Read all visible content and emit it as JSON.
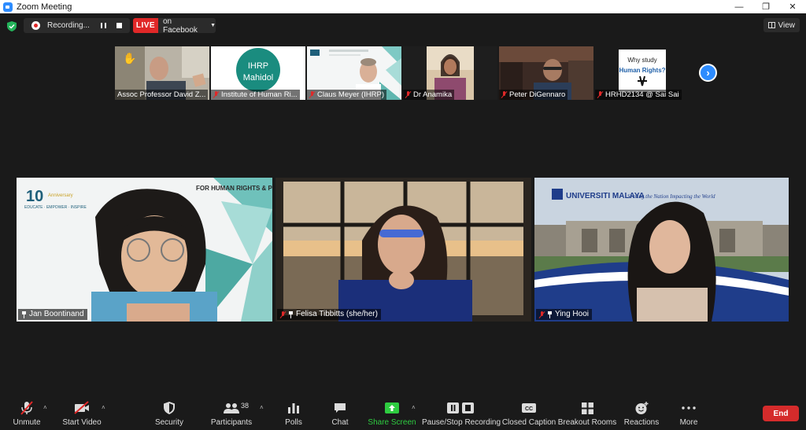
{
  "window": {
    "title": "Zoom Meeting"
  },
  "recording": {
    "status": "Recording..."
  },
  "live": {
    "badge": "LIVE",
    "target": "on Facebook"
  },
  "view": {
    "label": "View"
  },
  "thumbnails": [
    {
      "name": "Assoc Professor David Z...",
      "muted": false
    },
    {
      "name": "Institute of Human Ri...",
      "muted": true
    },
    {
      "name": "Claus Meyer (IHRP)",
      "muted": true
    },
    {
      "name": "Dr Anamika",
      "muted": true
    },
    {
      "name": "Peter DiGennaro",
      "muted": true
    },
    {
      "name": "HRHD2134 @ Sai Sai",
      "muted": true
    }
  ],
  "thumb_content": {
    "ihrp_logo": [
      "IHRP",
      "Mahidol"
    ],
    "why_study": [
      "Why study",
      "Human Rights?"
    ]
  },
  "tiles": [
    {
      "name": "Jan Boontinand",
      "banner": "FOR HUMAN RIGHTS & PEACE",
      "tagline": "EDUCATE · EMPOWER · INSPIRE",
      "anniv": "Anniversary"
    },
    {
      "name": "Felisa Tibbitts (she/her)"
    },
    {
      "name": "Ying Hooi",
      "org": "UNIVERSITI MALAYA",
      "motto": "Serving the Nation Impacting the World"
    }
  ],
  "toolbar": {
    "unmute": "Unmute",
    "start_video": "Start Video",
    "security": "Security",
    "participants": "Participants",
    "participants_count": "38",
    "polls": "Polls",
    "chat": "Chat",
    "share_screen": "Share Screen",
    "pause_stop_recording": "Pause/Stop Recording",
    "closed_caption": "Closed Caption",
    "closed_caption_icon_text": "CC",
    "breakout_rooms": "Breakout Rooms",
    "reactions": "Reactions",
    "more": "More",
    "end": "End"
  },
  "colors": {
    "accent": "#2d8cff",
    "live_red": "#e02828",
    "end_red": "#d52b2b",
    "share_green": "#2ecc40",
    "background": "#1a1a1a"
  }
}
